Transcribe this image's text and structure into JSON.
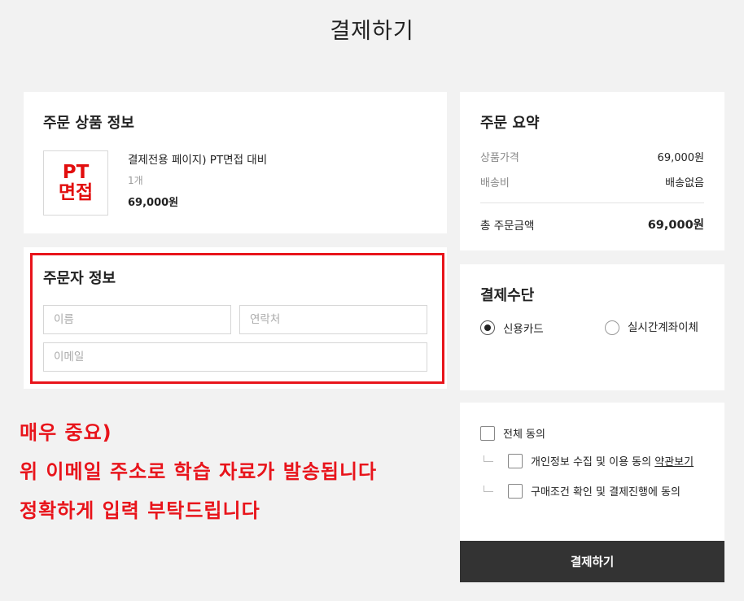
{
  "page": {
    "title": "결제하기"
  },
  "product": {
    "section_title": "주문 상품 정보",
    "thumb_line1": "PT",
    "thumb_line2": "면접",
    "name": "결제전용 페이지) PT면접 대비",
    "quantity": "1개",
    "price": "69,000원"
  },
  "orderer": {
    "section_title": "주문자 정보",
    "name_placeholder": "이름",
    "phone_placeholder": "연락처",
    "email_placeholder": "이메일"
  },
  "notice": {
    "line1": "매우 중요)",
    "line2": "위 이메일 주소로 학습 자료가 발송됩니다",
    "line3": "정확하게 입력 부탁드립니다"
  },
  "summary": {
    "section_title": "주문 요약",
    "product_price_label": "상품가격",
    "product_price_value": "69,000원",
    "shipping_label": "배송비",
    "shipping_value": "배송없음",
    "total_label": "총 주문금액",
    "total_value": "69,000원"
  },
  "payment": {
    "section_title": "결제수단",
    "option_card": "신용카드",
    "option_transfer": "실시간계좌이체",
    "selected": "신용카드"
  },
  "agreement": {
    "all_label": "전체 동의",
    "privacy_label": "개인정보 수집 및 이용 동의",
    "privacy_link": "약관보기",
    "purchase_label": "구매조건 확인 및 결제진행에 동의"
  },
  "submit": {
    "label": "결제하기"
  },
  "colors": {
    "background": "#f2f2f2",
    "accent_red": "#e8141b",
    "button_dark": "#333333"
  }
}
